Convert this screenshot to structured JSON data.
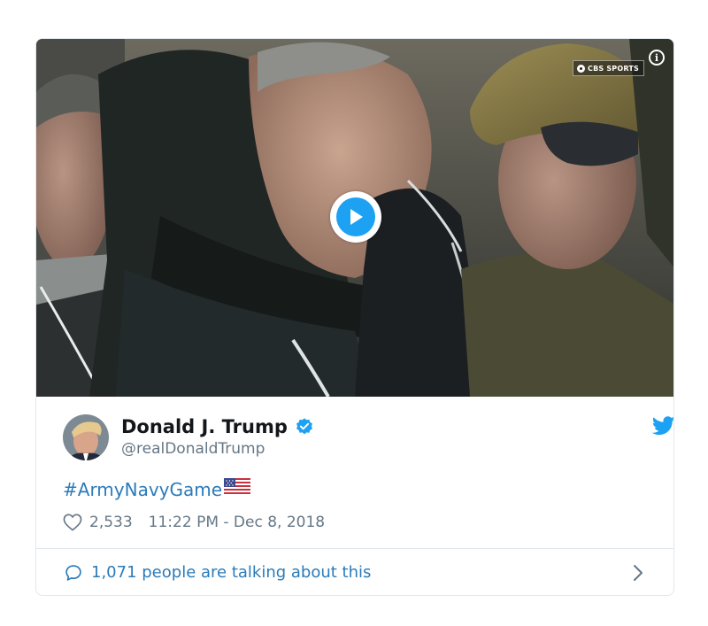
{
  "media": {
    "broadcaster_badge": "CBS SPORTS",
    "info_glyph": "i",
    "play_button": "play-icon"
  },
  "author": {
    "display_name": "Donald J. Trump",
    "handle": "@realDonaldTrump",
    "verified": true
  },
  "tweet": {
    "hashtag": "#ArmyNavyGame",
    "emoji": "us-flag-icon"
  },
  "meta": {
    "likes": "2,533",
    "timestamp": "11:22 PM - Dec 8, 2018"
  },
  "footer": {
    "talking_text": "1,071 people are talking about this"
  },
  "colors": {
    "twitter_blue": "#1da1f2",
    "link_blue": "#2b7bb9",
    "text_dark": "#14171a",
    "text_gray": "#657786",
    "border": "#e1e8ed"
  },
  "icons": [
    "play-icon",
    "info-icon",
    "verified-icon",
    "twitter-bird-icon",
    "us-flag-icon",
    "heart-icon",
    "speech-bubble-icon",
    "chevron-right-icon"
  ]
}
